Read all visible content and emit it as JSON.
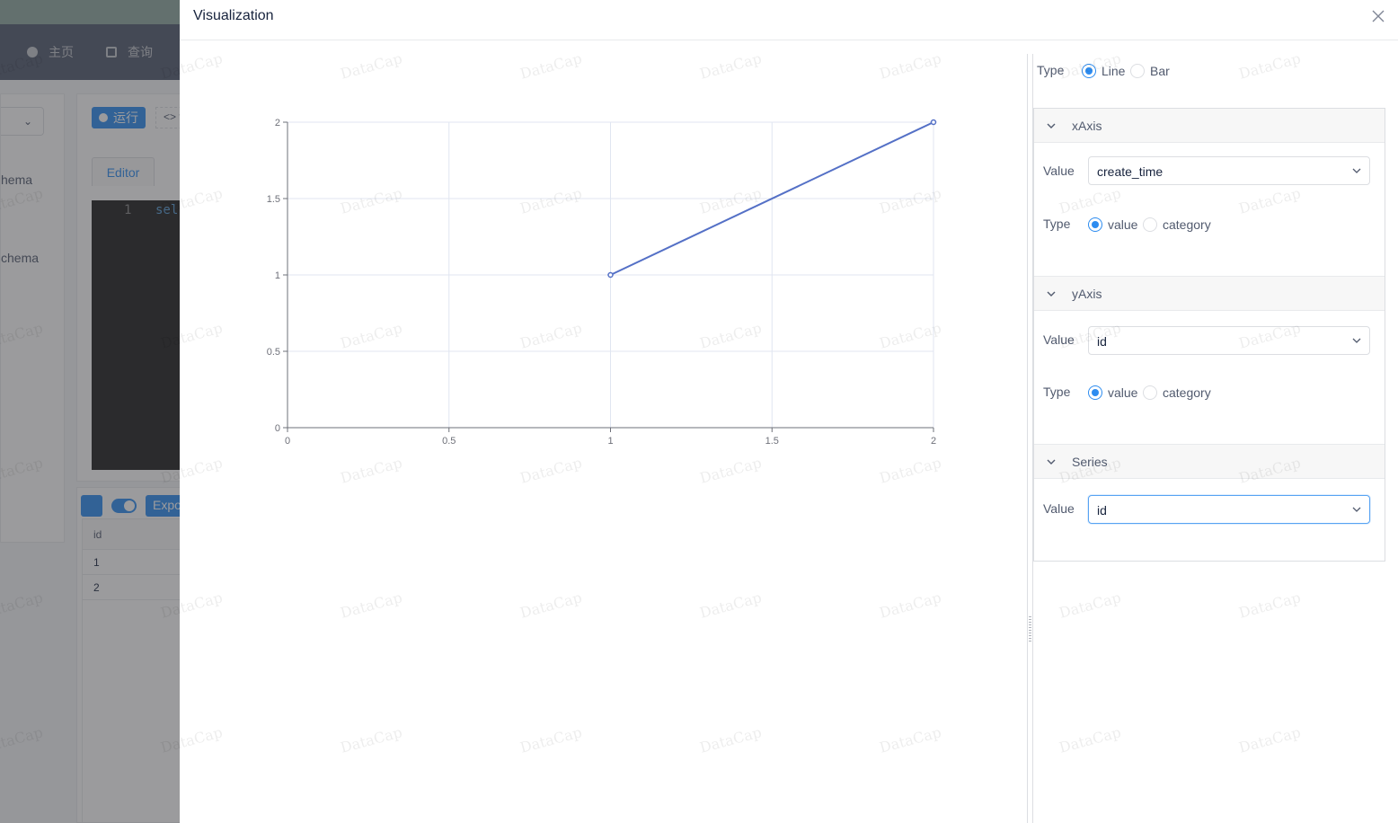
{
  "background": {
    "nav": [
      {
        "icon": "home-icon",
        "label": "主页"
      },
      {
        "icon": "query-icon",
        "label": "查询"
      }
    ],
    "left_items": [
      "hema",
      "chema"
    ],
    "run_label": "运行",
    "code_label": "<> f",
    "editor_tab": "Editor",
    "editor_line_number": "1",
    "editor_code": "sel",
    "export_label": "Export",
    "table_header": "id",
    "table_rows": [
      "1",
      "2"
    ]
  },
  "drawer": {
    "title": "Visualization",
    "close_icon": "close-icon"
  },
  "config": {
    "type_label": "Type",
    "chart_types": [
      {
        "label": "Line",
        "selected": true
      },
      {
        "label": "Bar",
        "selected": false
      }
    ],
    "panels": [
      {
        "title": "xAxis",
        "value_label": "Value",
        "value": "create_time",
        "type_label": "Type",
        "types": [
          {
            "label": "value",
            "selected": true
          },
          {
            "label": "category",
            "selected": false
          }
        ]
      },
      {
        "title": "yAxis",
        "value_label": "Value",
        "value": "id",
        "type_label": "Type",
        "types": [
          {
            "label": "value",
            "selected": true
          },
          {
            "label": "category",
            "selected": false
          }
        ]
      },
      {
        "title": "Series",
        "value_label": "Value",
        "value": "id"
      }
    ]
  },
  "watermark_text": "DataCap",
  "colors": {
    "accent": "#2d8cf0",
    "series_line": "#5470c6",
    "overlay": "rgba(55,55,60,0.5)"
  },
  "chart_data": {
    "type": "line",
    "x": [
      1,
      2
    ],
    "series": [
      {
        "values": [
          1,
          2
        ]
      }
    ],
    "xlim": [
      0,
      2
    ],
    "ylim": [
      0,
      2
    ],
    "xticks": [
      "0",
      "0.5",
      "1",
      "1.5",
      "2"
    ],
    "yticks": [
      "0",
      "0.5",
      "1",
      "1.5",
      "2"
    ],
    "grid": true
  }
}
